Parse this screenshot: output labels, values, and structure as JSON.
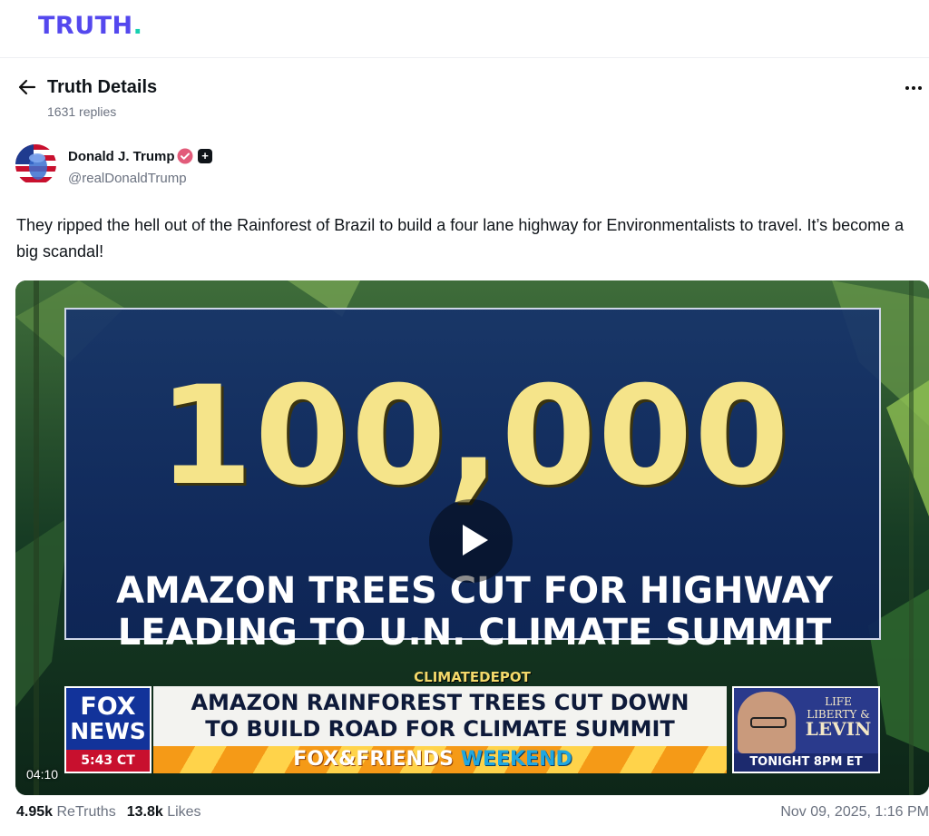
{
  "brand": {
    "name": "TRUTH",
    "dot": ".",
    "color": "#5448ee",
    "dot_color": "#17d0b0"
  },
  "header": {
    "title": "Truth Details",
    "replies": "1631 replies",
    "back_icon": "arrow-left-icon",
    "menu_icon": "more-horizontal-icon"
  },
  "author": {
    "name": "Donald J. Trump",
    "handle": "@realDonaldTrump",
    "verified_color": "#e25b7a"
  },
  "post": {
    "text": "They ripped the hell out of the Rainforest of Brazil to build a four lane highway for Environmentalists to travel. It’s become a big scandal!"
  },
  "video": {
    "big_number": "100,000",
    "headline_1": "AMAZON TREES CUT FOR HIGHWAY",
    "headline_2": "LEADING TO U.N. CLIMATE SUMMIT",
    "source_tag": "CLIMATEDEPOT",
    "network_1": "FOX",
    "network_2": "NEWS",
    "clock": "5:43 CT",
    "lower_third_1": "AMAZON RAINFOREST TREES CUT DOWN",
    "lower_third_2": "TO BUILD ROAD FOR CLIMATE SUMMIT",
    "show_name_a": "FOX&FRIENDS",
    "show_name_b": "WEEKEND",
    "promo_line_1": "LIFE LIBERTY &",
    "promo_line_2": "LEVIN",
    "promo_time": "TONIGHT 8PM ET",
    "duration": "04:10"
  },
  "stats": {
    "retruths_count": "4.95k",
    "retruths_label": "ReTruths",
    "likes_count": "13.8k",
    "likes_label": "Likes",
    "date": "Nov 09, 2025, 1:16 PM"
  }
}
